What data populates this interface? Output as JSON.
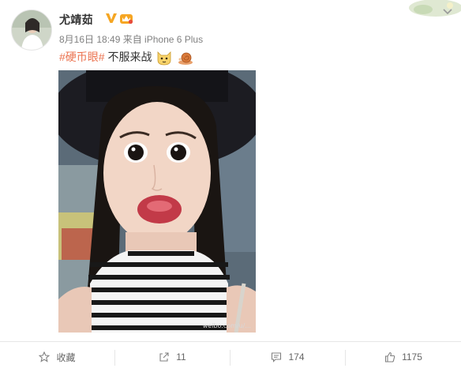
{
  "post": {
    "username": "尤靖茹",
    "meta": "8月16日 18:49 来自 iPhone 6 Plus",
    "hashtag": "#硬币眼#",
    "text": " 不服来战",
    "photo_watermark": "weibo.com/u/..."
  },
  "icons": {
    "verified": "verified-v-icon",
    "vip": "vip-crown-icon",
    "emoji_1": "cat-face-emoji",
    "emoji_2": "snail-emoji",
    "menu": "chevron-down-icon",
    "favorite": "star-icon",
    "repost": "share-arrow-icon",
    "comment": "comment-bubble-icon",
    "like": "thumbs-up-icon"
  },
  "actions": {
    "favorite_label": "收藏",
    "repost_count": "11",
    "comment_count": "174",
    "like_count": "1175"
  },
  "colors": {
    "hashtag": "#eb7350",
    "verified": "#f5a623",
    "username": "#333333",
    "meta": "#808080"
  }
}
